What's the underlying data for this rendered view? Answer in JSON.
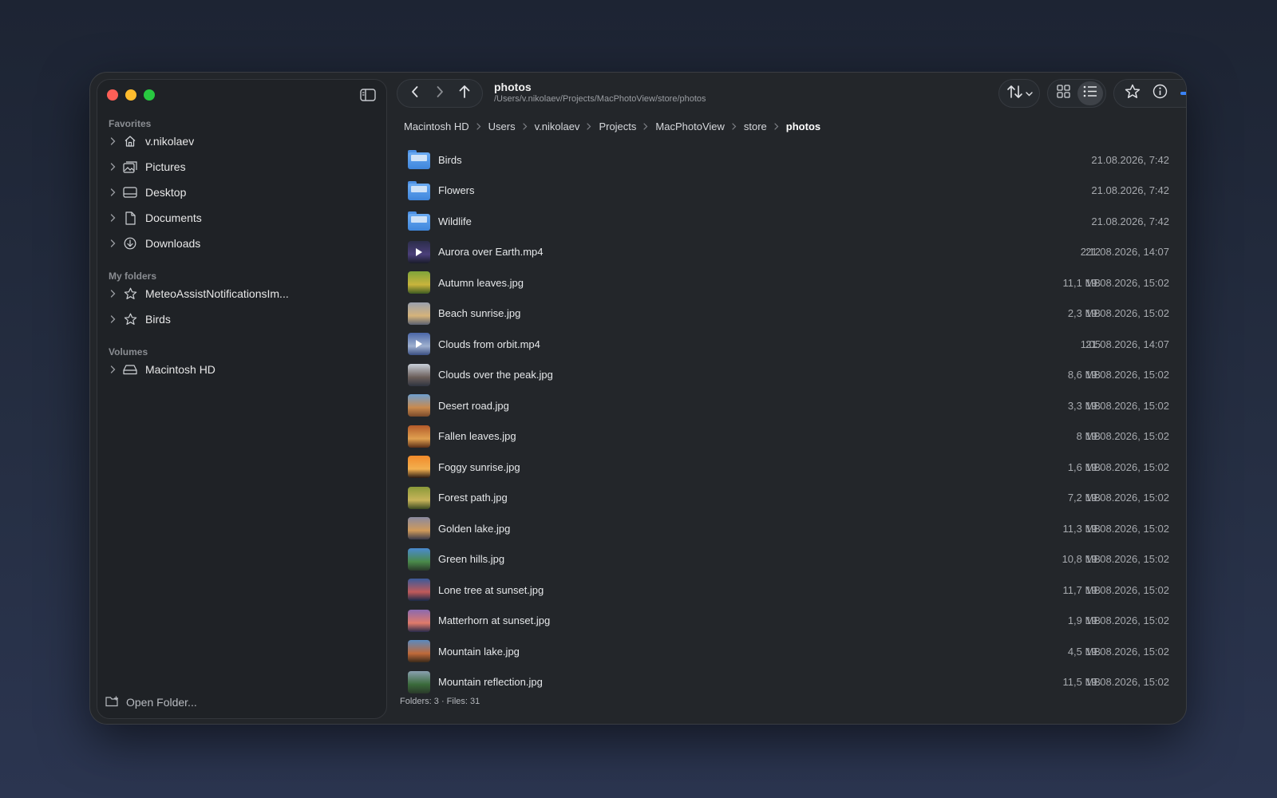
{
  "window": {
    "title": "photos",
    "path": "/Users/v.nikolaev/Projects/MacPhotoView/store/photos"
  },
  "sidebar": {
    "sections": [
      {
        "title": "Favorites",
        "items": [
          {
            "label": "v.nikolaev",
            "icon": "home-icon"
          },
          {
            "label": "Pictures",
            "icon": "photo-icon"
          },
          {
            "label": "Desktop",
            "icon": "desktop-icon"
          },
          {
            "label": "Documents",
            "icon": "document-icon"
          },
          {
            "label": "Downloads",
            "icon": "download-icon"
          }
        ]
      },
      {
        "title": "My folders",
        "items": [
          {
            "label": "MeteoAssistNotificationsIm...",
            "icon": "star-icon"
          },
          {
            "label": "Birds",
            "icon": "star-icon"
          }
        ]
      },
      {
        "title": "Volumes",
        "items": [
          {
            "label": "Macintosh HD",
            "icon": "drive-icon"
          }
        ]
      }
    ],
    "open_folder_label": "Open Folder..."
  },
  "toolbar": {
    "zoom_level": 0.15
  },
  "breadcrumb": [
    "Macintosh HD",
    "Users",
    "v.nikolaev",
    "Projects",
    "MacPhotoView",
    "store",
    "photos"
  ],
  "files": [
    {
      "name": "Birds",
      "type": "folder",
      "size": "",
      "date": "21.08.2026, 7:42"
    },
    {
      "name": "Flowers",
      "type": "folder",
      "size": "",
      "date": "21.08.2026, 7:42"
    },
    {
      "name": "Wildlife",
      "type": "folder",
      "size": "",
      "date": "21.08.2026, 7:42"
    },
    {
      "name": "Aurora over Earth.mp4",
      "type": "video",
      "size": "2:12",
      "date": "21.08.2026, 14:07",
      "colors": [
        "#2b2d4a",
        "#4b3f7a",
        "#1a1c2a"
      ]
    },
    {
      "name": "Autumn leaves.jpg",
      "type": "image",
      "size": "11,1 MB",
      "date": "19.08.2026, 15:02",
      "colors": [
        "#7fa53a",
        "#c9b43c",
        "#3e5b22"
      ]
    },
    {
      "name": "Beach sunrise.jpg",
      "type": "image",
      "size": "2,3 MB",
      "date": "19.08.2026, 15:02",
      "colors": [
        "#9aa0ad",
        "#d6b37a",
        "#5b6272"
      ]
    },
    {
      "name": "Clouds from orbit.mp4",
      "type": "video",
      "size": "1:05",
      "date": "21.08.2026, 14:07",
      "colors": [
        "#4a66a8",
        "#9eb0cf",
        "#3a4f82"
      ]
    },
    {
      "name": "Clouds over the peak.jpg",
      "type": "image",
      "size": "8,6 MB",
      "date": "19.08.2026, 15:02",
      "colors": [
        "#c9d0da",
        "#6b5e5a",
        "#2f3440"
      ]
    },
    {
      "name": "Desert road.jpg",
      "type": "image",
      "size": "3,3 MB",
      "date": "19.08.2026, 15:02",
      "colors": [
        "#6d9fd0",
        "#c98a4e",
        "#7a4a2a"
      ]
    },
    {
      "name": "Fallen leaves.jpg",
      "type": "image",
      "size": "8 MB",
      "date": "19.08.2026, 15:02",
      "colors": [
        "#b45a2a",
        "#e0a050",
        "#5a2e18"
      ]
    },
    {
      "name": "Foggy sunrise.jpg",
      "type": "image",
      "size": "1,6 MB",
      "date": "19.08.2026, 15:02",
      "colors": [
        "#f28a2a",
        "#f2b050",
        "#2a1a14"
      ]
    },
    {
      "name": "Forest path.jpg",
      "type": "image",
      "size": "7,2 MB",
      "date": "19.08.2026, 15:02",
      "colors": [
        "#8a9a3a",
        "#c8b45a",
        "#3a4a22"
      ]
    },
    {
      "name": "Golden lake.jpg",
      "type": "image",
      "size": "11,3 MB",
      "date": "19.08.2026, 15:02",
      "colors": [
        "#8a8aa0",
        "#d09a5a",
        "#3a3a4a"
      ]
    },
    {
      "name": "Green hills.jpg",
      "type": "image",
      "size": "10,8 MB",
      "date": "19.08.2026, 15:02",
      "colors": [
        "#4a8ad0",
        "#4a8a4a",
        "#2a3a2a"
      ]
    },
    {
      "name": "Lone tree at sunset.jpg",
      "type": "image",
      "size": "11,7 MB",
      "date": "19.08.2026, 15:02",
      "colors": [
        "#3a5a9a",
        "#c05a5a",
        "#1a2a4a"
      ]
    },
    {
      "name": "Matterhorn at sunset.jpg",
      "type": "image",
      "size": "1,9 MB",
      "date": "19.08.2026, 15:02",
      "colors": [
        "#8a6ab0",
        "#e07a6a",
        "#2a2a4a"
      ]
    },
    {
      "name": "Mountain lake.jpg",
      "type": "image",
      "size": "4,5 MB",
      "date": "19.08.2026, 15:02",
      "colors": [
        "#5a8ac0",
        "#c06a3a",
        "#3a2a1a"
      ]
    },
    {
      "name": "Mountain reflection.jpg",
      "type": "image",
      "size": "11,5 MB",
      "date": "19.08.2026, 15:02",
      "colors": [
        "#8aa0b0",
        "#3a6a3a",
        "#2a3a2a"
      ]
    },
    {
      "name": "",
      "type": "image",
      "size": "",
      "date": "",
      "colors": [
        "#1a3a8a",
        "#2a4aa0",
        "#10204a"
      ]
    }
  ],
  "status": {
    "summary": "Folders: 3 · Files: 31"
  }
}
